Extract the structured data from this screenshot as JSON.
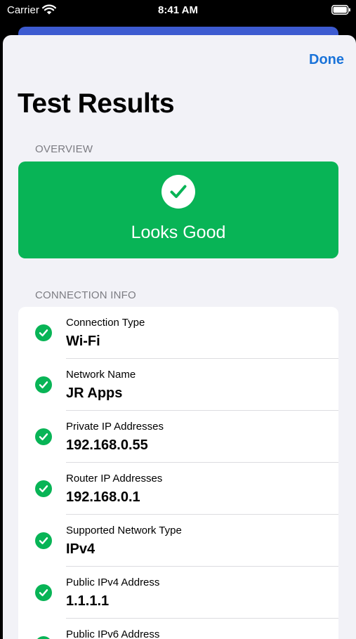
{
  "status_bar": {
    "carrier": "Carrier",
    "time": "8:41 AM",
    "wifi_icon": "wifi-icon",
    "battery_icon": "battery-icon"
  },
  "nav": {
    "done_label": "Done"
  },
  "title": "Test Results",
  "overview": {
    "header": "OVERVIEW",
    "status": "Looks Good",
    "icon": "checkmark-circle-icon"
  },
  "connection_info": {
    "header": "CONNECTION INFO",
    "rows": [
      {
        "label": "Connection Type",
        "value": "Wi-Fi",
        "icon": "checkmark-circle-icon"
      },
      {
        "label": "Network Name",
        "value": "JR Apps",
        "icon": "checkmark-circle-icon"
      },
      {
        "label": "Private IP Addresses",
        "value": "192.168.0.55",
        "icon": "checkmark-circle-icon"
      },
      {
        "label": "Router IP Addresses",
        "value": "192.168.0.1",
        "icon": "checkmark-circle-icon"
      },
      {
        "label": "Supported Network Type",
        "value": "IPv4",
        "icon": "checkmark-circle-icon"
      },
      {
        "label": "Public IPv4 Address",
        "value": "1.1.1.1",
        "icon": "checkmark-circle-icon"
      },
      {
        "label": "Public IPv6 Address",
        "value": "",
        "icon": "checkmark-circle-icon"
      }
    ]
  },
  "colors": {
    "accent": "#1a73d9",
    "success": "#08b456",
    "sheet_background": "#f2f2f7",
    "card_background": "#ffffff",
    "secondary_text": "#7c7c82"
  }
}
